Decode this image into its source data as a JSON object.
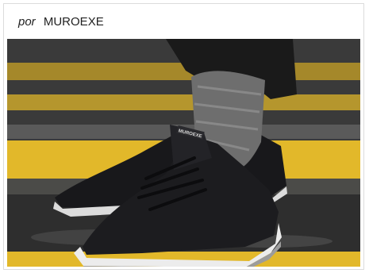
{
  "byline": {
    "prefix": "por",
    "brand": "MUROEXE"
  },
  "photo": {
    "shoe_logo_text": "MUROEXE",
    "colors": {
      "stripe": "#e2b82a",
      "pavement": "#3d3d3d",
      "shoe": "#1c1c1f",
      "sole": "#e8e8e8"
    }
  }
}
